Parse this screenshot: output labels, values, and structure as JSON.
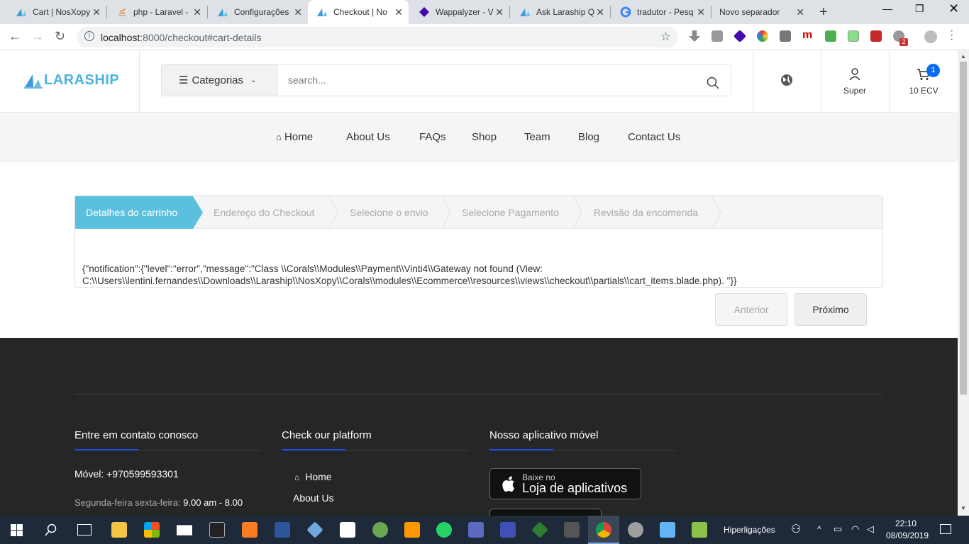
{
  "browser": {
    "tabs": [
      {
        "title": "Cart | NosXopy"
      },
      {
        "title": "php - Laravel - "
      },
      {
        "title": "Configurações"
      },
      {
        "title": "Checkout | No"
      },
      {
        "title": "Wappalyzer - V"
      },
      {
        "title": "Ask Laraship Q"
      },
      {
        "title": "tradutor - Pesq"
      },
      {
        "title": "Novo separador"
      }
    ],
    "url_host": "localhost",
    "url_rest": ":8000/checkout#cart-details",
    "ext_badge": "2"
  },
  "header": {
    "logo_text": "LARASHIP",
    "category_label": "Categorias",
    "search_placeholder": "search...",
    "user_label": "Super",
    "cart_label": "10 ECV",
    "cart_count": "1"
  },
  "nav": {
    "items": [
      "Home",
      "About Us",
      "FAQs",
      "Shop",
      "Team",
      "Blog",
      "Contact Us"
    ]
  },
  "wizard": {
    "steps": [
      "Detalhes do carrinho",
      "Endereço do Checkout",
      "Selecione o envio",
      "Selecione Pagamento",
      "Revisão da encomenda"
    ],
    "error_line1": "{\"notification\":{\"level\":\"error\",\"message\":\"Class \\\\Corals\\\\Modules\\\\Payment\\\\Vinti4\\\\Gateway not found (View:",
    "error_line2": "C:\\\\Users\\\\lentini.fernandes\\\\Downloads\\\\Laraship\\\\NosXopy\\\\Corals\\\\modules\\\\Ecommerce\\\\resources\\\\views\\\\checkout\\\\partials\\\\cart_items.blade.php). \"}}",
    "prev_label": "Anterior",
    "next_label": "Próximo"
  },
  "footer": {
    "col1_title": "Entre em contato conosco",
    "phone": "Móvel: +970599593301",
    "hours_label": "Segunda-feira sexta-feira:",
    "hours_value": "9.00 am - 8.00",
    "col2_title": "Check our platform",
    "links": [
      "Home",
      "About Us"
    ],
    "col3_title": "Nosso aplicativo móvel",
    "app_small": "Baixe no",
    "app_big": "Loja de aplicativos"
  },
  "taskbar": {
    "tray_label": "Hiperligações",
    "time": "22:10",
    "date": "08/09/2019"
  },
  "colors": {
    "accent": "#5bc0de",
    "footer_bg": "#262626",
    "badge": "#0b6bf3"
  }
}
